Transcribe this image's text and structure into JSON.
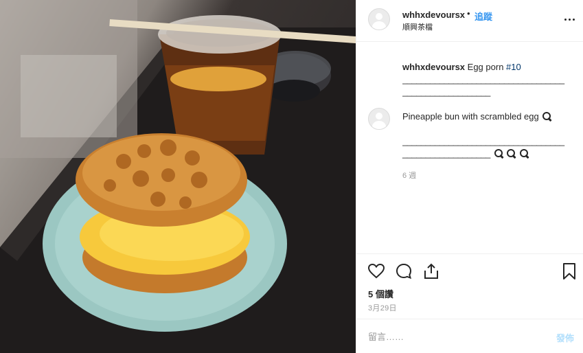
{
  "photo": {
    "description_icon": "photo-icon"
  },
  "header": {
    "username": "whhxdevoursx",
    "dot": "•",
    "follow_label": "追蹤",
    "location": "順興茶檔",
    "more_icon": "more-options-icon"
  },
  "caption": {
    "username": "whhxdevoursx",
    "text": "Egg porn",
    "hashtag": "#10",
    "line1": "___________________________________",
    "line2": "___________________"
  },
  "comment": {
    "text": "Pineapple bun with scrambled egg",
    "line1": "___________________________________",
    "line2": "___________________",
    "age": "6 週"
  },
  "actions": {
    "like_icon": "heart-icon",
    "comment_icon": "comment-icon",
    "share_icon": "share-icon",
    "save_icon": "bookmark-icon",
    "likes": "5 個讚",
    "date": "3月29日"
  },
  "add_comment": {
    "placeholder": "留言……",
    "post_label": "發佈"
  }
}
